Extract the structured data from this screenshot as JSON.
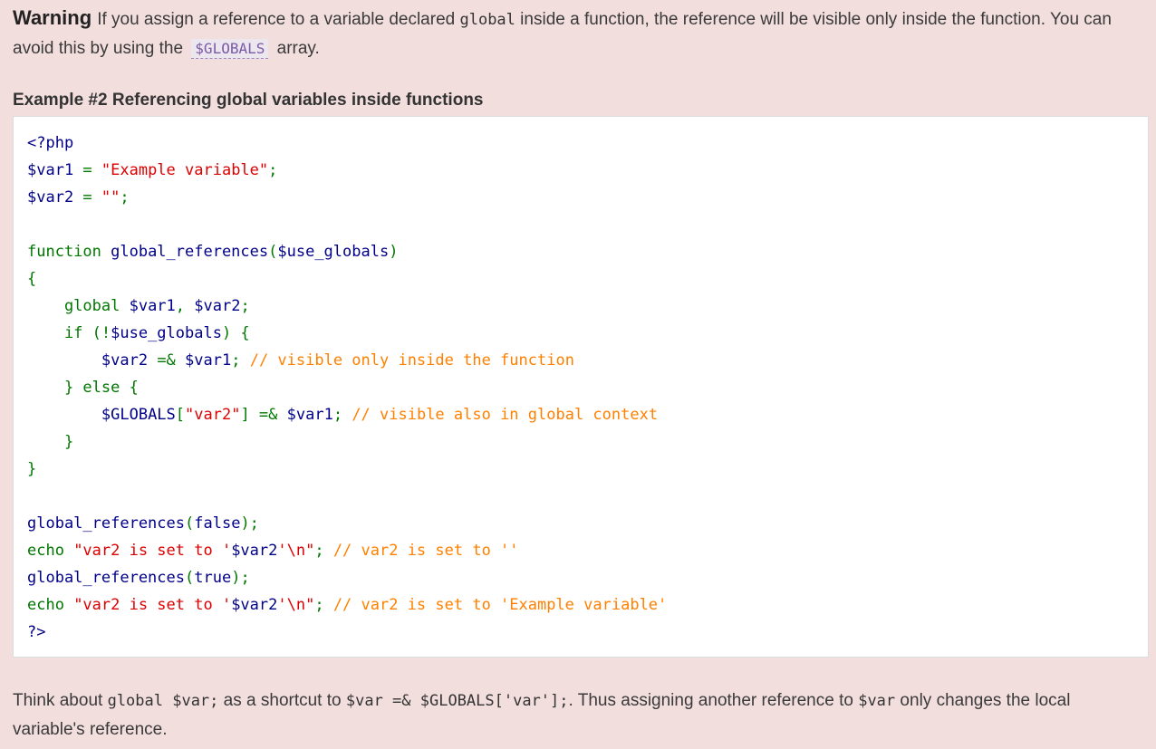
{
  "warning": {
    "label": "Warning",
    "text_1": "If you assign a reference to a variable declared ",
    "code_1": "global",
    "text_2": " inside a function, the reference will be visible only inside the function. You can avoid this by using the ",
    "link": "$GLOBALS",
    "text_3": " array."
  },
  "example": {
    "title": "Example #2 Referencing global variables inside functions",
    "code_lines": [
      [
        {
          "t": "<?php",
          "c": "default"
        }
      ],
      [
        {
          "t": "$var1 ",
          "c": "default"
        },
        {
          "t": "= ",
          "c": "keyword"
        },
        {
          "t": "\"Example variable\"",
          "c": "string"
        },
        {
          "t": ";",
          "c": "keyword"
        }
      ],
      [
        {
          "t": "$var2 ",
          "c": "default"
        },
        {
          "t": "= ",
          "c": "keyword"
        },
        {
          "t": "\"\"",
          "c": "string"
        },
        {
          "t": ";",
          "c": "keyword"
        }
      ],
      [],
      [
        {
          "t": "function ",
          "c": "keyword"
        },
        {
          "t": "global_references",
          "c": "default"
        },
        {
          "t": "(",
          "c": "keyword"
        },
        {
          "t": "$use_globals",
          "c": "default"
        },
        {
          "t": ")",
          "c": "keyword"
        }
      ],
      [
        {
          "t": "{",
          "c": "keyword"
        }
      ],
      [
        {
          "t": "    global ",
          "c": "keyword"
        },
        {
          "t": "$var1",
          "c": "default"
        },
        {
          "t": ", ",
          "c": "keyword"
        },
        {
          "t": "$var2",
          "c": "default"
        },
        {
          "t": ";",
          "c": "keyword"
        }
      ],
      [
        {
          "t": "    if (!",
          "c": "keyword"
        },
        {
          "t": "$use_globals",
          "c": "default"
        },
        {
          "t": ") {",
          "c": "keyword"
        }
      ],
      [
        {
          "t": "        ",
          "c": "keyword"
        },
        {
          "t": "$var2 ",
          "c": "default"
        },
        {
          "t": "=& ",
          "c": "keyword"
        },
        {
          "t": "$var1",
          "c": "default"
        },
        {
          "t": "; ",
          "c": "keyword"
        },
        {
          "t": "// visible only inside the function",
          "c": "comment"
        }
      ],
      [
        {
          "t": "    } else {",
          "c": "keyword"
        }
      ],
      [
        {
          "t": "        ",
          "c": "keyword"
        },
        {
          "t": "$GLOBALS",
          "c": "default"
        },
        {
          "t": "[",
          "c": "keyword"
        },
        {
          "t": "\"var2\"",
          "c": "string"
        },
        {
          "t": "] =& ",
          "c": "keyword"
        },
        {
          "t": "$var1",
          "c": "default"
        },
        {
          "t": "; ",
          "c": "keyword"
        },
        {
          "t": "// visible also in global context",
          "c": "comment"
        }
      ],
      [
        {
          "t": "    }",
          "c": "keyword"
        }
      ],
      [
        {
          "t": "}",
          "c": "keyword"
        }
      ],
      [],
      [
        {
          "t": "global_references",
          "c": "default"
        },
        {
          "t": "(",
          "c": "keyword"
        },
        {
          "t": "false",
          "c": "default"
        },
        {
          "t": ");",
          "c": "keyword"
        }
      ],
      [
        {
          "t": "echo ",
          "c": "keyword"
        },
        {
          "t": "\"var2 is set to '",
          "c": "string"
        },
        {
          "t": "$var2",
          "c": "default"
        },
        {
          "t": "'\\n\"",
          "c": "string"
        },
        {
          "t": "; ",
          "c": "keyword"
        },
        {
          "t": "// var2 is set to ''",
          "c": "comment"
        }
      ],
      [
        {
          "t": "global_references",
          "c": "default"
        },
        {
          "t": "(",
          "c": "keyword"
        },
        {
          "t": "true",
          "c": "default"
        },
        {
          "t": ");",
          "c": "keyword"
        }
      ],
      [
        {
          "t": "echo ",
          "c": "keyword"
        },
        {
          "t": "\"var2 is set to '",
          "c": "string"
        },
        {
          "t": "$var2",
          "c": "default"
        },
        {
          "t": "'\\n\"",
          "c": "string"
        },
        {
          "t": "; ",
          "c": "keyword"
        },
        {
          "t": "// var2 is set to 'Example variable'",
          "c": "comment"
        }
      ],
      [
        {
          "t": "?>",
          "c": "default"
        }
      ]
    ]
  },
  "bottom": {
    "text_1": "Think about ",
    "code_1": "global $var;",
    "text_2": " as a shortcut to ",
    "code_2": "$var =& $GLOBALS['var'];",
    "text_3": ". Thus assigning another reference to ",
    "code_3": "$var",
    "text_4": " only changes the local variable's reference."
  },
  "colors": {
    "background": "#f3dede",
    "code_default": "#000088",
    "code_keyword": "#007700",
    "code_string": "#dd0000",
    "code_comment": "#ff8000"
  }
}
